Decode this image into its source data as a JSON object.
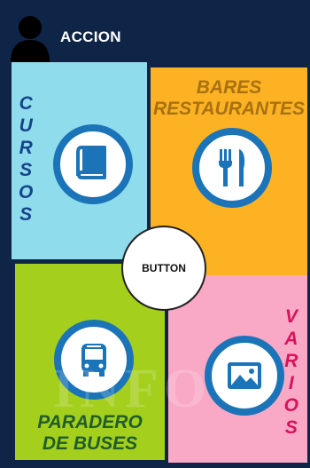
{
  "header": {
    "title": "ACCION"
  },
  "panels": {
    "cursos": {
      "letters": [
        "C",
        "U",
        "R",
        "S",
        "O",
        "S"
      ]
    },
    "bares": {
      "line1": "BARES",
      "line2": "RESTAURANTES"
    },
    "buses": {
      "line1": "PARADERO",
      "line2": "DE BUSES"
    },
    "varios": {
      "letters": [
        "V",
        "A",
        "R",
        "I",
        "O",
        "S"
      ]
    }
  },
  "center_button": {
    "label": "BUTTON"
  },
  "icons": [
    "user-icon",
    "book-icon",
    "fork-knife-icon",
    "bus-icon",
    "picture-icon"
  ],
  "colors": {
    "background": "#0e2547",
    "cursos": "#8fdcec",
    "bares": "#fdb224",
    "buses": "#a5cf1d",
    "varios": "#f9a8c6",
    "icon_blue": "#1b74b8"
  }
}
